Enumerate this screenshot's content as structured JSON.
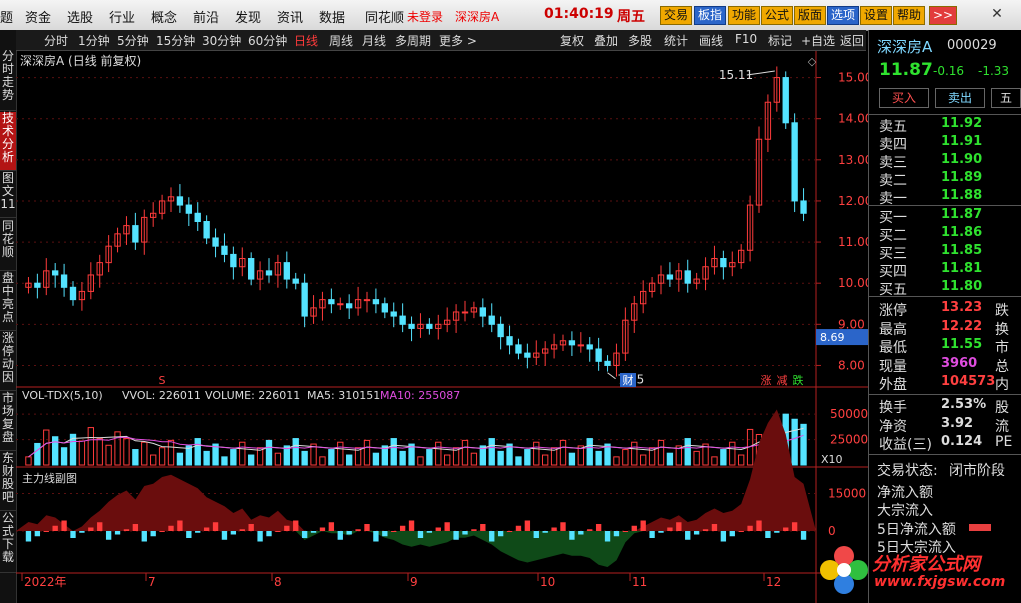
{
  "menu": {
    "items": [
      "题",
      "资金",
      "选股",
      "行业",
      "概念",
      "前沿",
      "发现",
      "资讯",
      "数据",
      "同花顺"
    ],
    "login_warning": "未登录",
    "stock_name": "深深房A",
    "time": "01:40:19",
    "weekday": "周五",
    "buttons": [
      "交易",
      "板指",
      "功能",
      "公式",
      "版面",
      "选项",
      "设置",
      "帮助"
    ],
    "more": ">>"
  },
  "toolbar": {
    "periods": [
      "分时",
      "1分钟",
      "5分钟",
      "15分钟",
      "30分钟",
      "60分钟",
      "日线",
      "周线",
      "月线",
      "多周期",
      "更多 >"
    ],
    "active": "日线",
    "tools": [
      "复权",
      "叠加",
      "多股",
      "统计",
      "画线",
      "F10",
      "标记",
      "+自选",
      "返回"
    ]
  },
  "sidetabs": [
    "分时走势",
    "技术分析",
    "图文11",
    "同花顺",
    "盘中亮点",
    "涨停动因",
    "市场复盘",
    "东财股吧",
    "公式下载"
  ],
  "chart": {
    "title": "深深房A (日线 前复权)",
    "high_label": "15.11",
    "low_label": "7.75",
    "price_ticks": [
      "15.00",
      "14.00",
      "13.00",
      "12.00",
      "11.00",
      "10.00",
      "9.00",
      "8.00"
    ],
    "price_marker": "8.69",
    "event_markers": [
      "S",
      "财",
      "涨",
      "减",
      "跌"
    ],
    "volume_title": {
      "name": "VOL-TDX(5,10)",
      "vvol": "VVOL: 226011",
      "volume": "VOLUME: 226011",
      "ma5": "MA5: 310151",
      "ma10": "MA10: 255087"
    },
    "volume_ticks": [
      "50000",
      "25000"
    ],
    "volume_unit": "X10",
    "sub_title": "主力线副图",
    "sub_ticks": [
      "15000",
      "0"
    ],
    "dates": [
      "2022年",
      "7",
      "8",
      "9",
      "10",
      "11",
      "12"
    ]
  },
  "chart_data": {
    "type": "candlestick",
    "title": "深深房A (日线 前复权)",
    "price_ylim": [
      7.5,
      15.5
    ],
    "annotations": {
      "high": 15.11,
      "low": 7.75,
      "marker": 8.69
    },
    "closes": [
      10.0,
      9.9,
      10.3,
      10.2,
      9.9,
      9.6,
      9.8,
      10.2,
      10.5,
      10.9,
      11.2,
      11.4,
      11.0,
      11.6,
      11.7,
      12.0,
      12.1,
      11.9,
      11.7,
      11.5,
      11.1,
      10.9,
      10.7,
      10.4,
      10.6,
      10.1,
      10.3,
      10.2,
      10.5,
      10.1,
      10.0,
      9.2,
      9.4,
      9.6,
      9.5,
      9.5,
      9.4,
      9.6,
      9.6,
      9.5,
      9.3,
      9.2,
      9.0,
      8.9,
      9.0,
      8.9,
      9.0,
      9.1,
      9.3,
      9.3,
      9.4,
      9.2,
      9.0,
      8.7,
      8.5,
      8.3,
      8.2,
      8.3,
      8.4,
      8.5,
      8.6,
      8.5,
      8.5,
      8.4,
      8.1,
      8.0,
      8.3,
      9.1,
      9.5,
      9.8,
      10.0,
      10.2,
      10.1,
      10.3,
      10.0,
      10.1,
      10.4,
      10.6,
      10.4,
      10.5,
      10.8,
      11.9,
      13.5,
      14.4,
      15.0,
      13.9,
      12.0,
      11.7
    ],
    "volume_ticks": [
      50000,
      25000
    ],
    "volume_unit": "X10",
    "volume_series": {
      "vvol": 226011,
      "volume": 226011,
      "ma5": 310151,
      "ma10": 255087
    },
    "sub_ticks": [
      15000,
      0
    ],
    "x_labels": [
      "2022年",
      "7",
      "8",
      "9",
      "10",
      "11",
      "12"
    ]
  },
  "right_panel": {
    "name": "深深房A",
    "code": "000029",
    "price": "11.87",
    "change": "-0.16",
    "pct": "-1.33",
    "buy": "买入",
    "sell": "卖出",
    "extra": "五",
    "asks": [
      [
        "卖五",
        "11.92"
      ],
      [
        "卖四",
        "11.91"
      ],
      [
        "卖三",
        "11.90"
      ],
      [
        "卖二",
        "11.89"
      ],
      [
        "卖一",
        "11.88"
      ]
    ],
    "bids": [
      [
        "买一",
        "11.87"
      ],
      [
        "买二",
        "11.86"
      ],
      [
        "买三",
        "11.85"
      ],
      [
        "买四",
        "11.81"
      ],
      [
        "买五",
        "11.80"
      ]
    ],
    "stats": [
      [
        "涨停",
        "13.23",
        "跌"
      ],
      [
        "最高",
        "12.22",
        "换"
      ],
      [
        "最低",
        "11.55",
        "市"
      ],
      [
        "现量",
        "3960",
        "总"
      ],
      [
        "外盘",
        "104573",
        "内"
      ]
    ],
    "stats2": [
      [
        "换手",
        "2.53%",
        "股"
      ],
      [
        "净资",
        "3.92",
        "流"
      ],
      [
        "收益(三)",
        "0.124",
        "PE"
      ]
    ],
    "status_label": "交易状态:",
    "status": "闭市阶段",
    "flows": [
      "净流入额",
      "大宗流入",
      "5日净流入额",
      "5日大宗流入"
    ]
  },
  "logo": {
    "text": "分析家公式网",
    "url": "www.fxjgsw.com"
  }
}
